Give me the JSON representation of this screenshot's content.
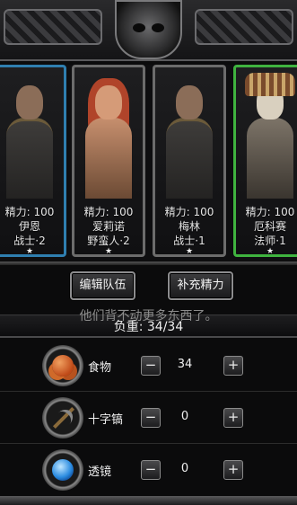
{
  "heroes": [
    {
      "energy_label": "精力: 100",
      "name": "伊恩",
      "class": "战士·2",
      "stars": "★",
      "frame": "blue"
    },
    {
      "energy_label": "精力: 100",
      "name": "爱莉诺",
      "class": "野蛮人·2",
      "stars": "★",
      "frame": "gray"
    },
    {
      "energy_label": "精力: 100",
      "name": "梅林",
      "class": "战士·1",
      "stars": "★",
      "frame": "gray"
    },
    {
      "energy_label": "精力: 100",
      "name": "厄科赛",
      "class": "法师·1",
      "stars": "★",
      "frame": "green"
    }
  ],
  "buttons": {
    "edit_team": "编辑队伍",
    "refill_energy": "补充精力"
  },
  "tip": "他们背不动更多东西了。",
  "weight_label": "负重: 34/34",
  "items": [
    {
      "name": "食物",
      "quantity": "34",
      "icon": "food-icon",
      "minus": "−",
      "plus": "+"
    },
    {
      "name": "十字镐",
      "quantity": "0",
      "icon": "pickaxe-icon",
      "minus": "−",
      "plus": "+"
    },
    {
      "name": "透镜",
      "quantity": "0",
      "icon": "lens-icon",
      "minus": "−",
      "plus": "+"
    }
  ],
  "colors": {
    "frame_blue": "#2f7fb0",
    "frame_green": "#3fb33f",
    "frame_gray": "#6c6c6c"
  }
}
